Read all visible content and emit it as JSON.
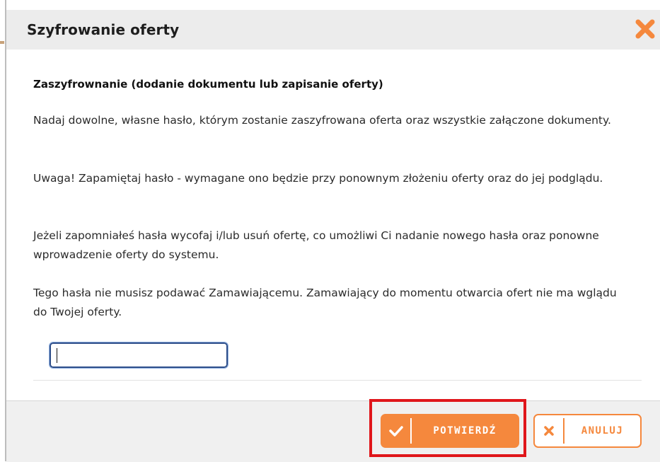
{
  "dialog": {
    "title": "Szyfrowanie oferty",
    "close_icon": "close-x-icon"
  },
  "content": {
    "heading": "Zaszyfrownanie (dodanie dokumentu lub zapisanie oferty)",
    "paragraphs": [
      "Nadaj dowolne, własne hasło, którym zostanie zaszyfrowana oferta oraz wszystkie załączone dokumenty.",
      "Uwaga! Zapamiętaj hasło - wymagane ono będzie przy ponownym złożeniu oferty oraz do jej podglądu.",
      "Jeżeli zapomniałeś hasła wycofaj i/lub usuń ofertę, co umożliwi Ci nadanie nowego hasła oraz ponowne wprowadzenie oferty do systemu.",
      "Tego hasła nie musisz podawać Zamawiającemu. Zamawiający do momentu otwarcia ofert nie ma wglądu do Twojej oferty."
    ],
    "password_value": ""
  },
  "footer": {
    "confirm_label": "POTWIERDŹ",
    "confirm_icon": "checkmark-icon",
    "cancel_label": "ANULUJ",
    "cancel_icon": "x-icon"
  },
  "colors": {
    "accent": "#f5883d",
    "highlight": "#e0161b",
    "header_bg": "#ececec",
    "footer_bg": "#f0f0f0"
  }
}
